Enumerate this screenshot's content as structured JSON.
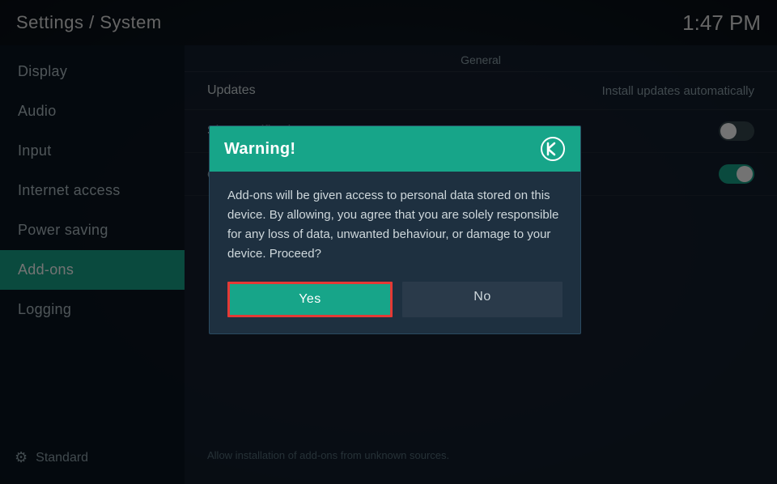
{
  "header": {
    "title": "Settings / System",
    "time": "1:47 PM"
  },
  "sidebar": {
    "items": [
      {
        "id": "display",
        "label": "Display",
        "active": false
      },
      {
        "id": "audio",
        "label": "Audio",
        "active": false
      },
      {
        "id": "input",
        "label": "Input",
        "active": false
      },
      {
        "id": "internet-access",
        "label": "Internet access",
        "active": false
      },
      {
        "id": "power-saving",
        "label": "Power saving",
        "active": false
      },
      {
        "id": "add-ons",
        "label": "Add-ons",
        "active": true
      },
      {
        "id": "logging",
        "label": "Logging",
        "active": false
      }
    ],
    "footer_label": "Standard"
  },
  "main": {
    "section_label": "General",
    "rows": [
      {
        "id": "updates",
        "label": "Updates",
        "value": "Install updates automatically",
        "type": "text"
      },
      {
        "id": "show-notifications",
        "label": "Show notifications",
        "value": "",
        "type": "toggle-off"
      },
      {
        "id": "unknown-sources",
        "label": "",
        "value": "",
        "type": "toggle-on"
      }
    ],
    "repositories_label": "Official repositories only (default)",
    "footer_text": "Allow installation of add-ons from unknown sources."
  },
  "dialog": {
    "title": "Warning!",
    "body": "Add-ons will be given access to personal data stored on this device. By allowing, you agree that you are solely responsible for any loss of data, unwanted behaviour, or damage to your device. Proceed?",
    "btn_yes": "Yes",
    "btn_no": "No"
  }
}
